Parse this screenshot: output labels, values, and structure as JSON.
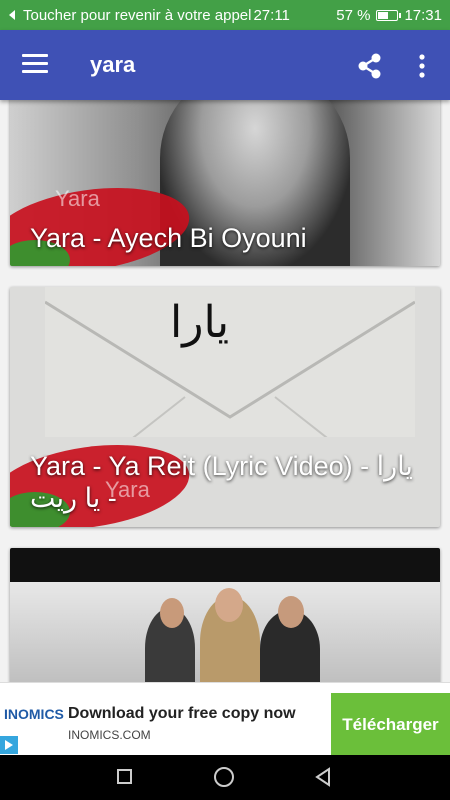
{
  "status_bar": {
    "call_text": "Toucher pour revenir à votre appel",
    "call_timer": "27:11",
    "battery_percent": "57 %",
    "battery_level": 0.57,
    "time": "17:31",
    "color": "#43a047"
  },
  "app_bar": {
    "title": "yara",
    "color": "#3f51b5",
    "menu_icon": "hamburger-menu-icon",
    "share_icon": "share-icon",
    "overflow_icon": "more-vert-icon"
  },
  "feed": {
    "videos": [
      {
        "title": "Yara - Ayech Bi Oyouni",
        "watermark": "Yara"
      },
      {
        "title": "Yara - Ya Reit (Lyric Video) - يارا - يا ريت",
        "watermark": "Yara",
        "arabic_logo": "يارا"
      },
      {
        "title": ""
      }
    ]
  },
  "ad": {
    "advertiser": "INOMICS",
    "title": "Download your free copy now",
    "domain": "INOMICS.COM",
    "cta": "Télécharger",
    "cta_color": "#6bbf3a",
    "adchoices_icon": "adchoices-icon"
  },
  "nav_bar": {
    "recents_icon": "recents-square-icon",
    "home_icon": "home-circle-icon",
    "back_icon": "back-triangle-icon"
  }
}
